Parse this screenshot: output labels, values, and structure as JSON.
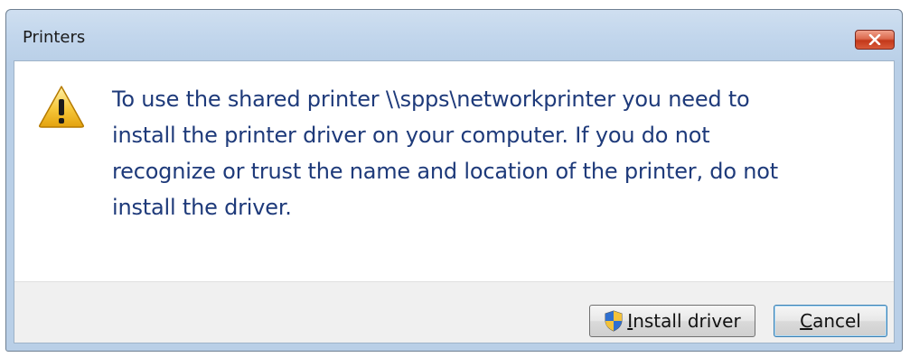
{
  "window": {
    "title": "Printers",
    "close_icon": "close-icon"
  },
  "message": {
    "icon": "warning-icon",
    "lines": [
      "To use the shared printer \\\\spps\\networkprinter you need to",
      "install the printer driver on your computer.  If you do not",
      "recognize or trust the name and location of the printer, do not",
      "install the driver."
    ]
  },
  "buttons": {
    "install": {
      "icon": "uac-shield-icon",
      "mnemonic": "I",
      "label_rest": "nstall driver"
    },
    "cancel": {
      "mnemonic": "C",
      "label_rest": "ancel"
    }
  },
  "colors": {
    "message_text": "#1e3a7a",
    "title_bar": "#c2d6ec",
    "close_button": "#c3381a",
    "footer": "#f0f0f0"
  }
}
